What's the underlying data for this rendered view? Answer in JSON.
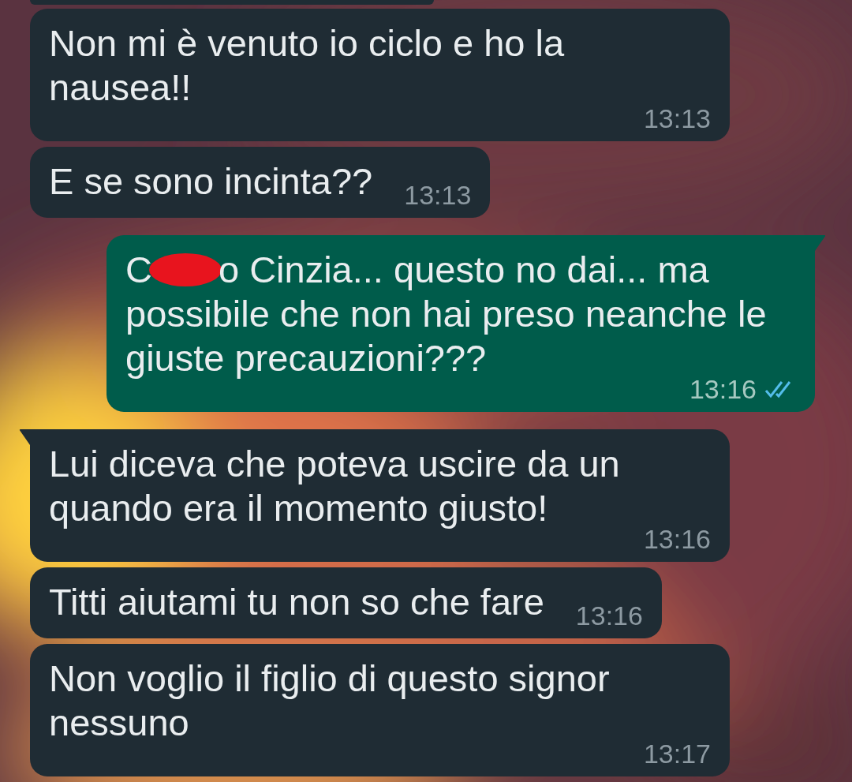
{
  "messages": [
    {
      "kind": "cut"
    },
    {
      "kind": "incoming",
      "tail": false,
      "lines": [
        [
          {
            "kind": "text",
            "text": "Non mi è venuto io ciclo e ho la nausea!!"
          }
        ]
      ],
      "time": "13:13"
    },
    {
      "kind": "incoming",
      "tail": false,
      "lines": [
        [
          {
            "kind": "text",
            "text": "E se sono incinta??"
          }
        ]
      ],
      "time": "13:13"
    },
    {
      "kind": "outgoing",
      "tail": true,
      "lines": [
        [
          {
            "kind": "text",
            "text": "C"
          },
          {
            "kind": "redaction"
          },
          {
            "kind": "text",
            "text": "o Cinzia... questo no dai... ma"
          }
        ],
        [
          {
            "kind": "text",
            "text": "possibile che non hai preso neanche le giuste precauzioni???"
          }
        ]
      ],
      "time": "13:16",
      "read": true
    },
    {
      "kind": "incoming",
      "tail": true,
      "lines": [
        [
          {
            "kind": "text",
            "text": "Lui diceva che poteva uscire da un quando era il momento giusto!"
          }
        ]
      ],
      "time": "13:16"
    },
    {
      "kind": "incoming",
      "tail": false,
      "lines": [
        [
          {
            "kind": "text",
            "text": "Titti aiutami tu non so che fare"
          }
        ]
      ],
      "time": "13:16"
    },
    {
      "kind": "incoming",
      "tail": false,
      "lines": [
        [
          {
            "kind": "text",
            "text": "Non voglio il figlio di questo signor nessuno"
          }
        ]
      ],
      "time": "13:17"
    }
  ]
}
